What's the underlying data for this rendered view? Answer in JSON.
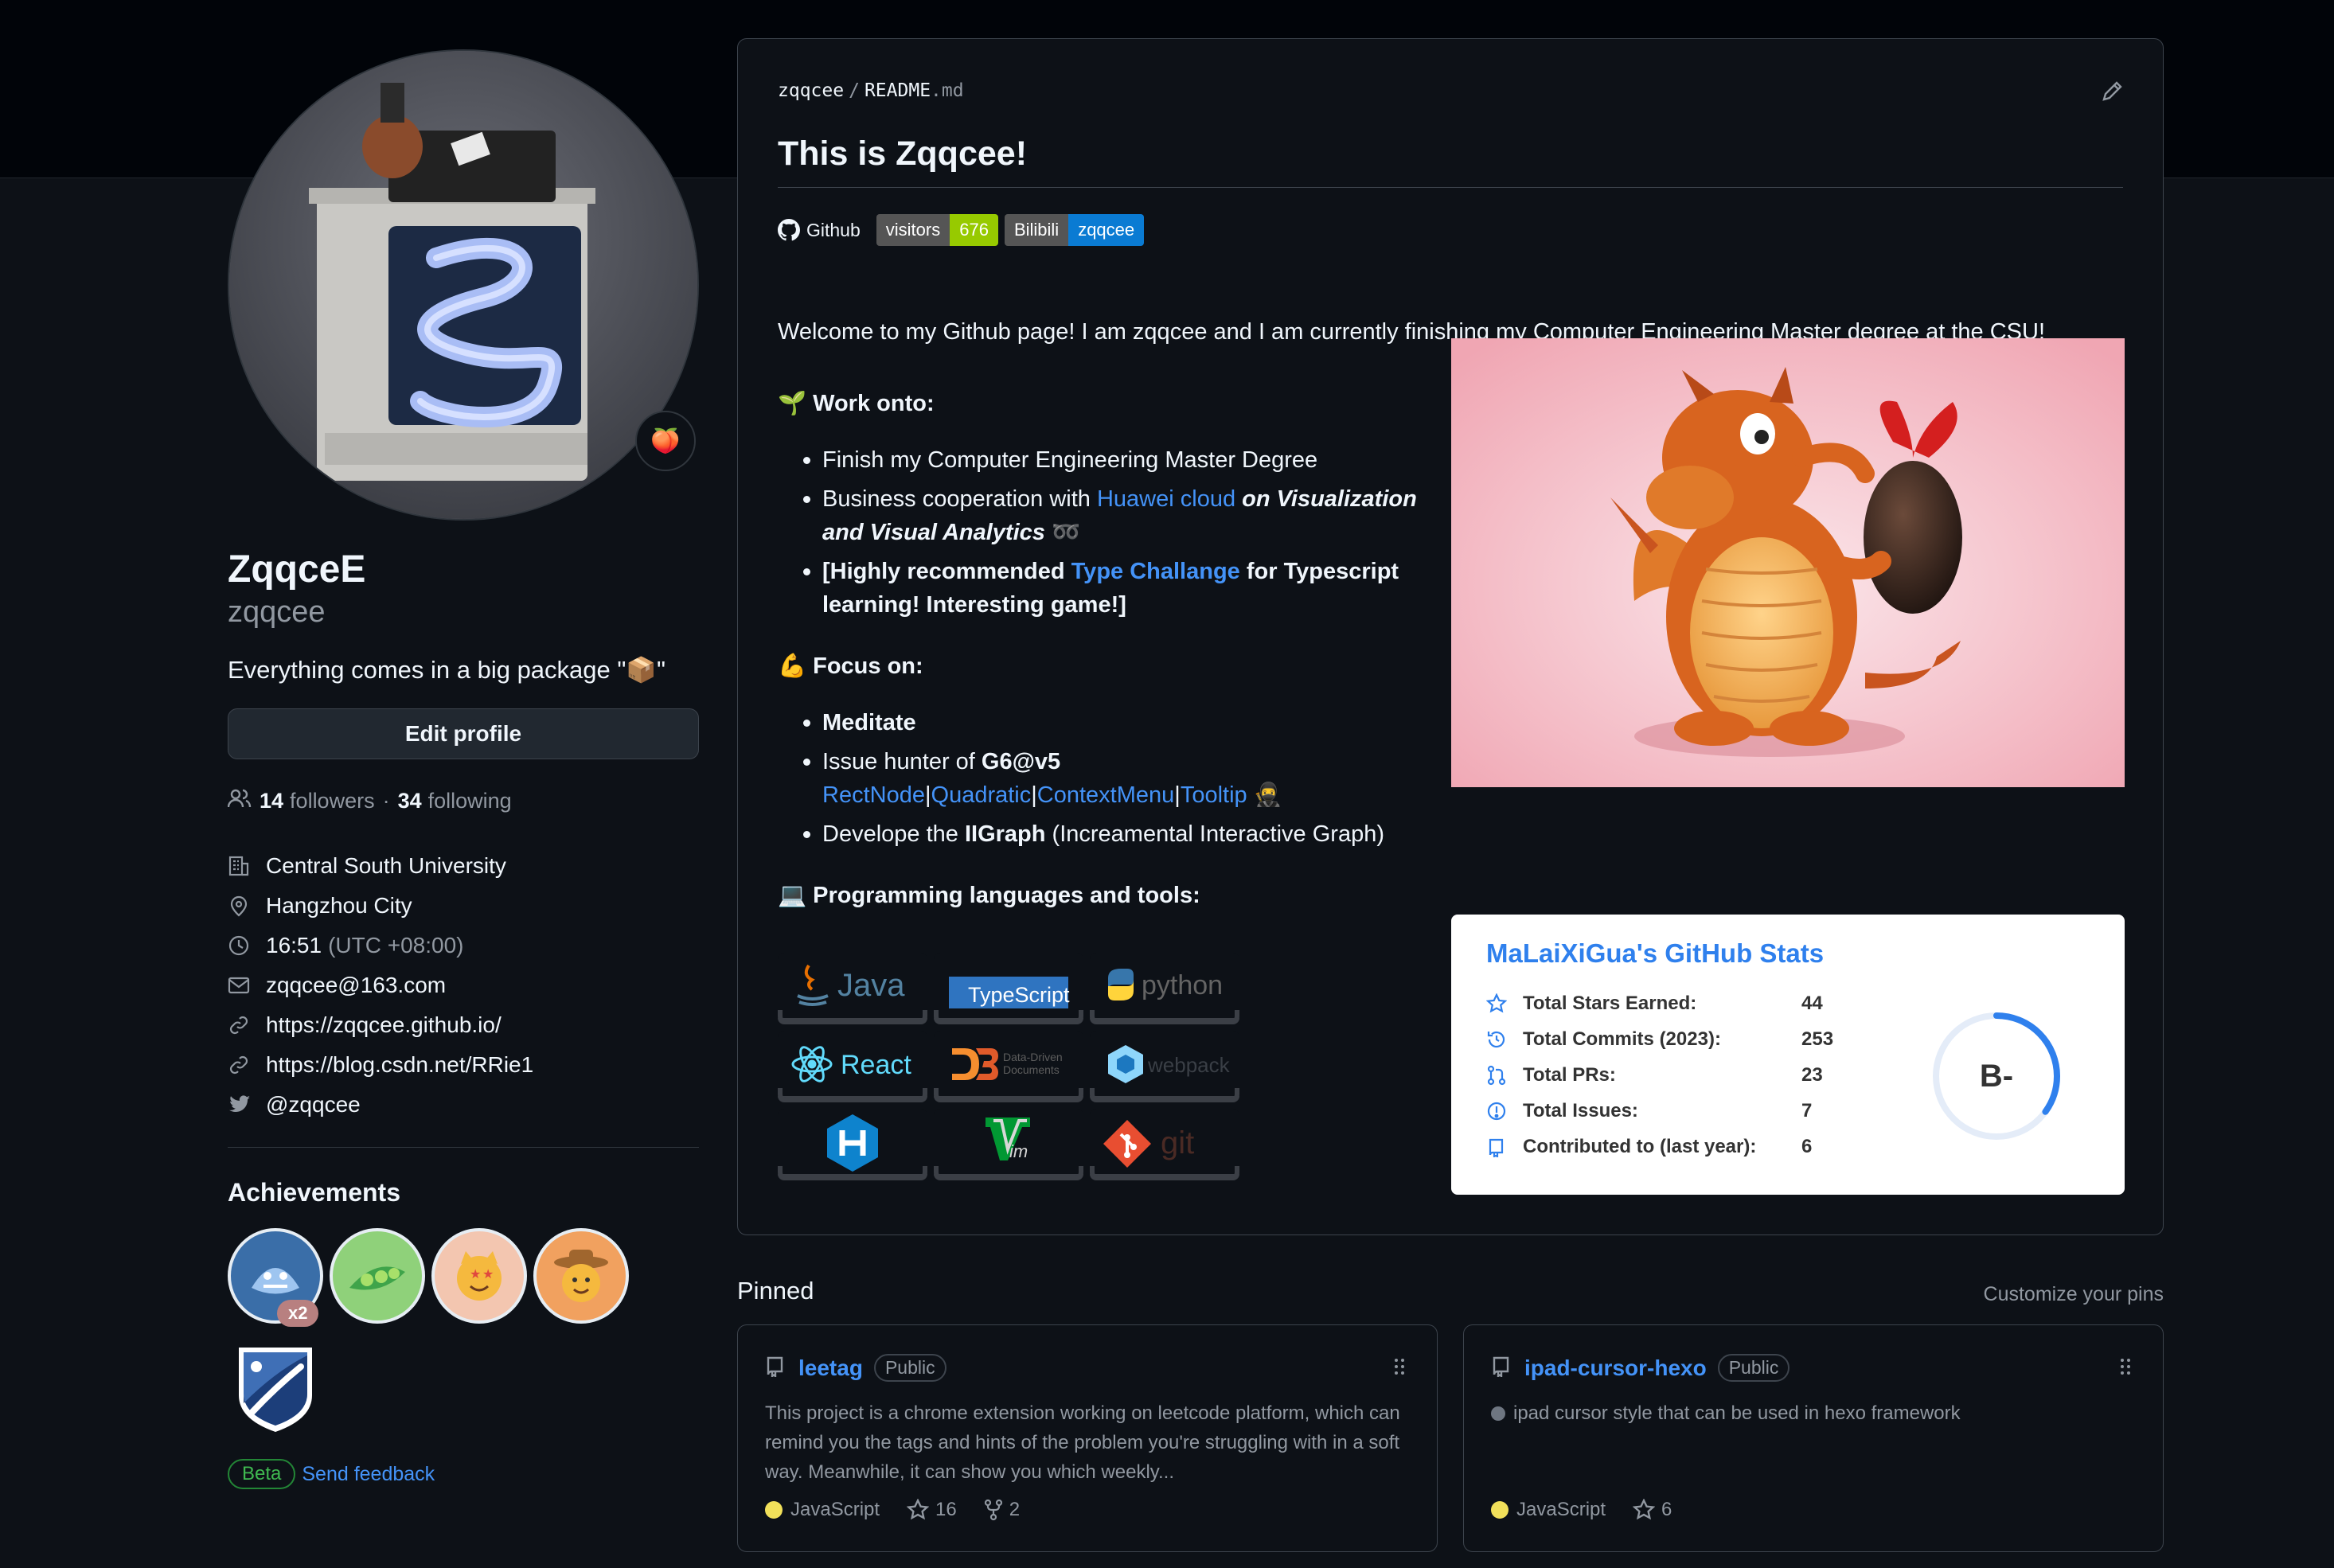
{
  "profile": {
    "status_emoji": "🍑",
    "name": "ZqqceE",
    "login": "zqqcee",
    "bio": "Everything comes in a big package \"📦\"",
    "edit_label": "Edit profile",
    "followers_count": "14",
    "followers_label": "followers",
    "separator": "·",
    "following_count": "34",
    "following_label": "following",
    "details": {
      "organization": "Central South University",
      "location": "Hangzhou City",
      "time": "16:51",
      "timezone": "(UTC +08:00)",
      "email": "zqqcee@163.com",
      "website": "https://zqqcee.github.io/",
      "blog": "https://blog.csdn.net/RRie1",
      "twitter": "@zqqcee"
    },
    "achievements_title": "Achievements",
    "badge_count": "x2",
    "beta_label": "Beta",
    "feedback_label": "Send feedback"
  },
  "readme": {
    "path_user": "zqqcee",
    "path_sep": "/",
    "path_file": "README",
    "path_ext": ".md",
    "title": "This is Zqqcee!",
    "github_label": "Github",
    "visitors_label": "visitors",
    "visitors_count": "676",
    "bilibili_label": "Bilibili",
    "bilibili_value": "zqqcee",
    "welcome": "Welcome to my Github page! I am zqqcee and I am currently finishing my Computer Engineering Master degree at the CSU!",
    "work_emoji": "🌱",
    "work_title": "Work onto:",
    "work_1": "Finish my Computer Engineering Master Degree",
    "work_2_pre": "Business cooperation with ",
    "work_2_link": "Huawei cloud",
    "work_2_mid": " on ",
    "work_2_bold": "Visualization and Visual Analytics",
    "work_2_emoji": "➿",
    "work_3_pre": "[Highly recommended ",
    "work_3_link": "Type Challange",
    "work_3_post": " for Typescript learning! Interesting game!]",
    "focus_emoji": "💪",
    "focus_title": "Focus on:",
    "focus_1": "Meditate",
    "focus_2_pre": "Issue hunter of ",
    "focus_2_bold": "G6@v5",
    "focus_2_links": [
      "RectNode",
      "Quadratic",
      "ContextMenu",
      "Tooltip"
    ],
    "focus_2_sep": "|",
    "focus_2_emoji": "🥷",
    "focus_3_pre": "Develope the ",
    "focus_3_bold": "IIGraph",
    "focus_3_post": " (Increamental Interactive Graph)",
    "tools_emoji": "💻",
    "tools_title": "Programming languages and tools:",
    "tools": {
      "java": "Java",
      "typescript": "TypeScript",
      "python": "python",
      "react": "React",
      "d3_line1": "Data-Driven",
      "d3_line2": "Documents",
      "webpack": "webpack",
      "git": "git"
    }
  },
  "stats": {
    "title": "MaLaiXiGua's GitHub Stats",
    "rows": [
      {
        "label": "Total Stars Earned:",
        "value": "44"
      },
      {
        "label": "Total Commits (2023):",
        "value": "253"
      },
      {
        "label": "Total PRs:",
        "value": "23"
      },
      {
        "label": "Total Issues:",
        "value": "7"
      },
      {
        "label": "Contributed to (last year):",
        "value": "6"
      }
    ],
    "grade": "B-",
    "ring_fraction": 0.35,
    "accent": "#2f80ed"
  },
  "pinned": {
    "title": "Pinned",
    "customize": "Customize your pins",
    "repos": [
      {
        "name": "leetag",
        "visibility": "Public",
        "description": "This project is a chrome extension working on leetcode platform, which can remind you the tags and hints of the problem you're struggling with in a soft way. Meanwhile, it can show you which weekly...",
        "language": "JavaScript",
        "stars": "16",
        "forks": "2"
      },
      {
        "name": "ipad-cursor-hexo",
        "visibility": "Public",
        "description": "ipad cursor style that can be used in hexo framework",
        "language": "JavaScript",
        "stars": "6"
      }
    ]
  },
  "colors": {
    "background": "#0d1117",
    "link": "#4493f8",
    "javascript": "#f1e05a"
  }
}
